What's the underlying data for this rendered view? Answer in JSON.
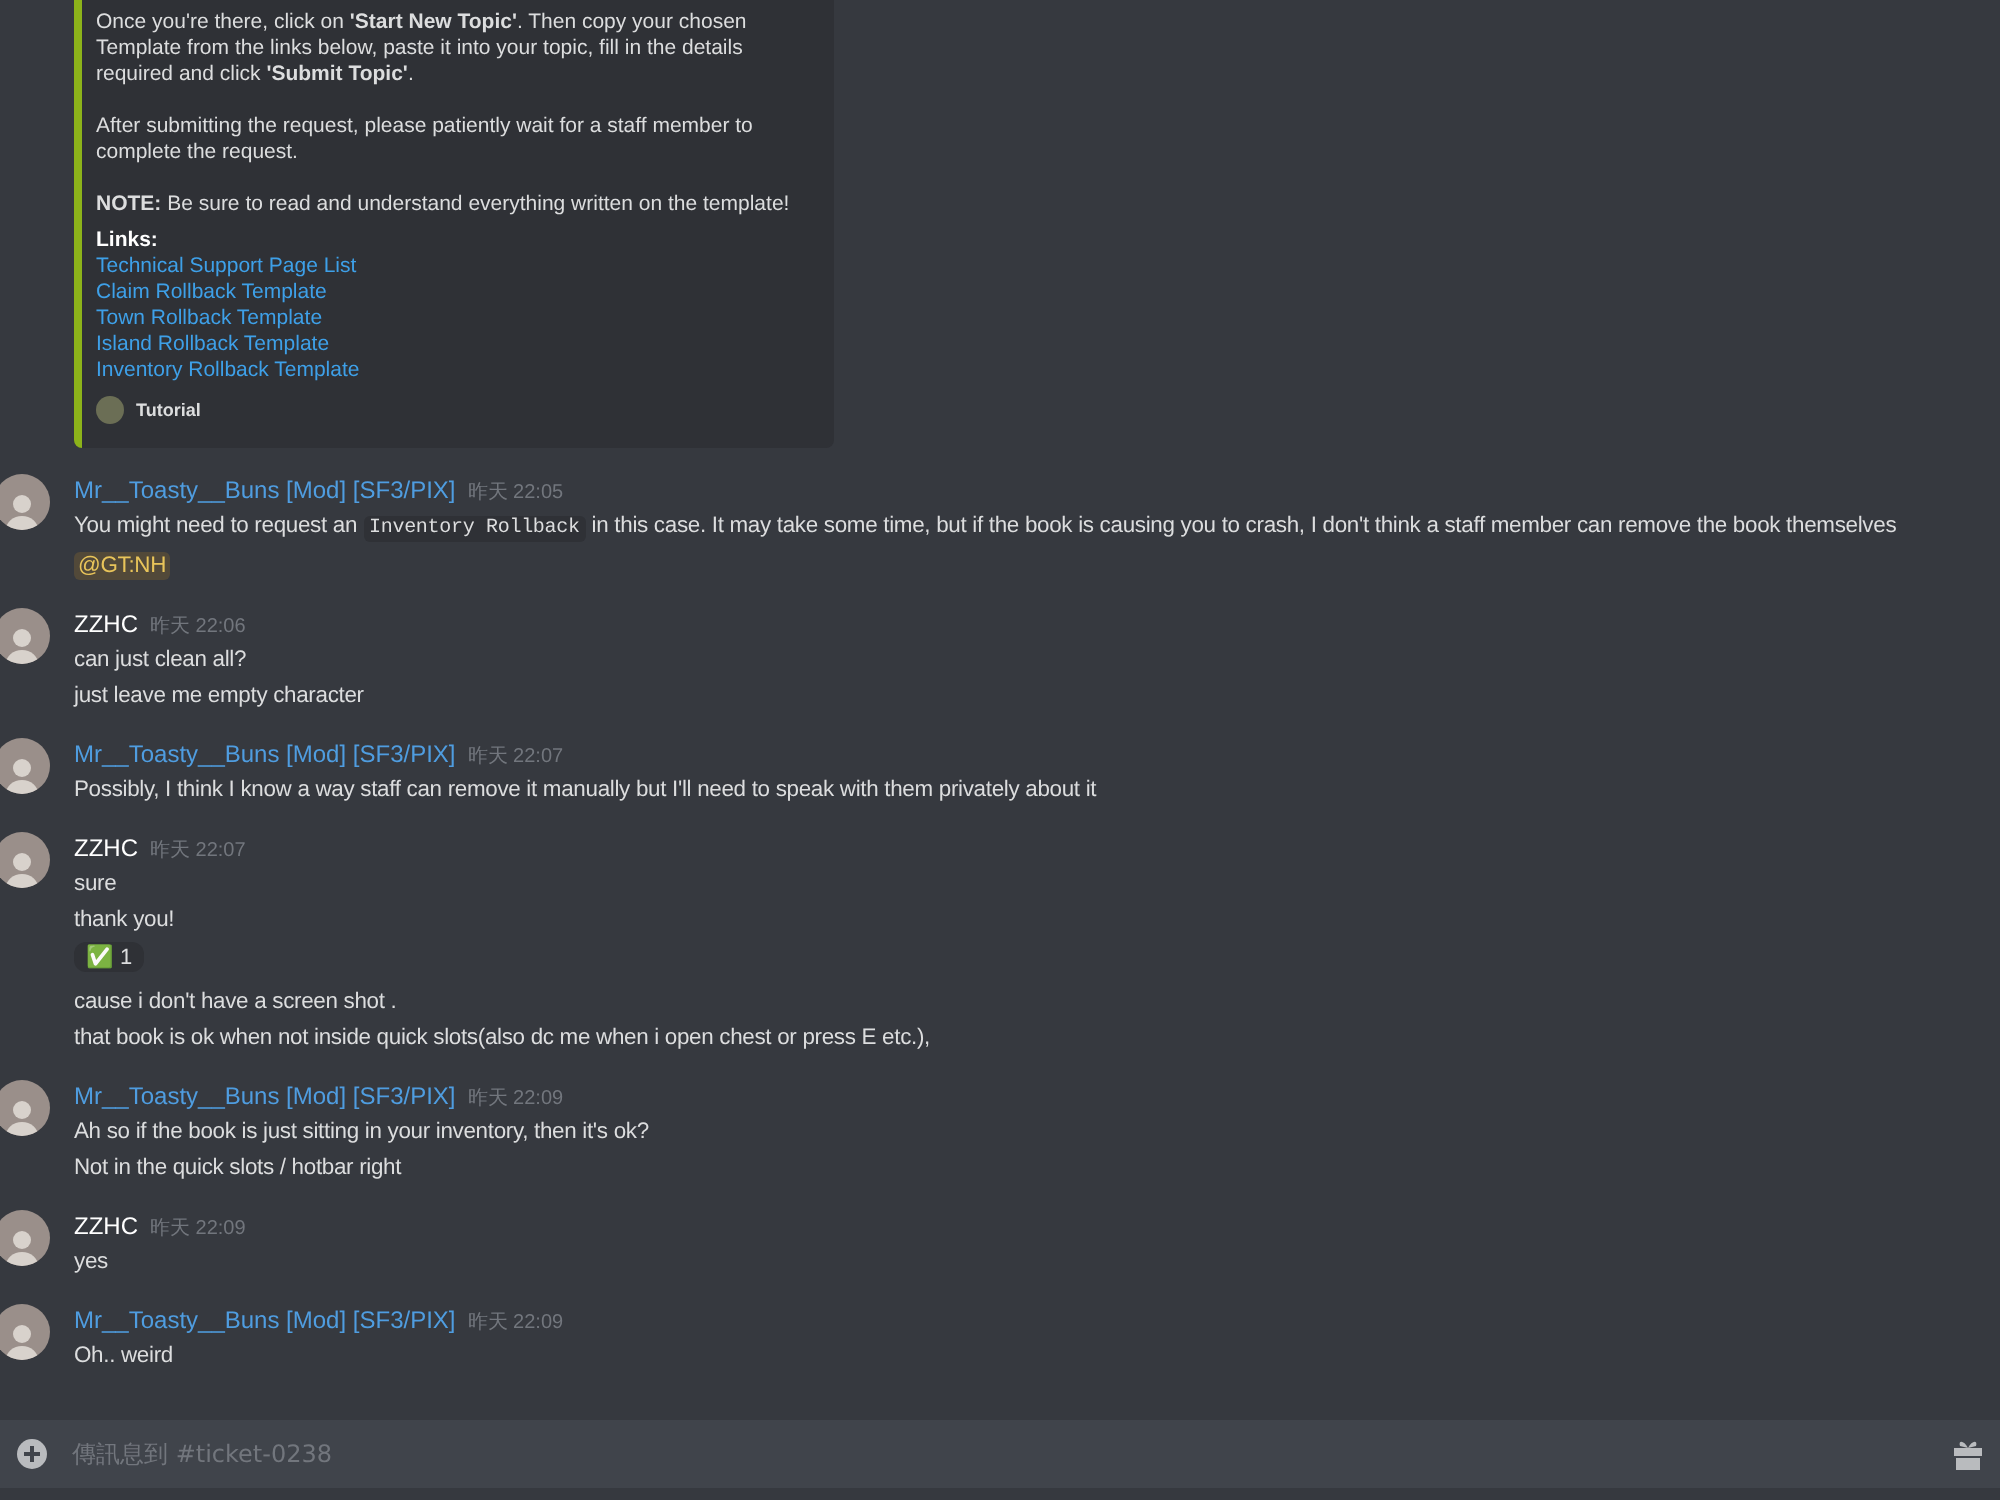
{
  "embed": {
    "paragraphs": [
      "Once you're there, click on **'Start New Topic'**. Then copy your chosen Template from the links below, paste it into your topic, fill in the details required and click **'Submit Topic'**.",
      "After submitting the request, please patiently wait for a staff member to complete the request.",
      "**NOTE:** Be sure to read and understand everything written on the template!"
    ],
    "links_heading": "Links:",
    "links": [
      "Technical Support Page List",
      "Claim Rollback Template",
      "Town Rollback Template",
      "Island Rollback Template",
      "Inventory Rollback Template"
    ],
    "footer": "Tutorial"
  },
  "messages": [
    {
      "author": "Mr__Toasty__Buns [Mod] [SF3/PIX]",
      "color": "#4f9de0",
      "time": "昨天 22:05",
      "lines": [
        {
          "kind": "text",
          "parts": [
            {
              "kind": "text",
              "text": "You might need to request an "
            },
            {
              "kind": "code",
              "text": "Inventory Rollback"
            },
            {
              "kind": "text",
              "text": " in this case. It may take some time, but if the book is causing you to crash, I don't think a staff member can remove the book themselves"
            }
          ]
        },
        {
          "kind": "text",
          "parts": [
            {
              "kind": "mention",
              "text": "@GT:NH"
            }
          ]
        }
      ]
    },
    {
      "author": "ZZHC",
      "color": "#ffffff",
      "time": "昨天 22:06",
      "lines": [
        {
          "kind": "text",
          "parts": [
            {
              "kind": "text",
              "text": "can just clean all?"
            }
          ]
        },
        {
          "kind": "text",
          "parts": [
            {
              "kind": "text",
              "text": "just leave me  empty character"
            }
          ]
        }
      ]
    },
    {
      "author": "Mr__Toasty__Buns [Mod] [SF3/PIX]",
      "color": "#4f9de0",
      "time": "昨天 22:07",
      "lines": [
        {
          "kind": "text",
          "parts": [
            {
              "kind": "text",
              "text": "Possibly, I think I know a way staff can remove it manually but I'll need to speak with them privately about it"
            }
          ]
        }
      ]
    },
    {
      "author": "ZZHC",
      "color": "#ffffff",
      "time": "昨天 22:07",
      "lines": [
        {
          "kind": "text",
          "parts": [
            {
              "kind": "text",
              "text": "sure"
            }
          ]
        },
        {
          "kind": "text",
          "parts": [
            {
              "kind": "text",
              "text": "thank you!"
            }
          ]
        },
        {
          "kind": "reaction",
          "emoji": "✅",
          "count": "1"
        },
        {
          "kind": "text",
          "parts": [
            {
              "kind": "text",
              "text": "cause i don't have a screen shot ."
            }
          ]
        },
        {
          "kind": "text",
          "parts": [
            {
              "kind": "text",
              "text": "that book is ok when not inside quick slots(also dc me when i open chest or press E etc.),"
            }
          ]
        }
      ]
    },
    {
      "author": "Mr__Toasty__Buns [Mod] [SF3/PIX]",
      "color": "#4f9de0",
      "time": "昨天 22:09",
      "lines": [
        {
          "kind": "text",
          "parts": [
            {
              "kind": "text",
              "text": "Ah so if the book is just sitting in your inventory, then it's ok?"
            }
          ]
        },
        {
          "kind": "text",
          "parts": [
            {
              "kind": "text",
              "text": "Not in the quick slots / hotbar right"
            }
          ]
        }
      ]
    },
    {
      "author": "ZZHC",
      "color": "#ffffff",
      "time": "昨天 22:09",
      "lines": [
        {
          "kind": "text",
          "parts": [
            {
              "kind": "text",
              "text": "yes"
            }
          ]
        }
      ]
    },
    {
      "author": "Mr__Toasty__Buns [Mod] [SF3/PIX]",
      "color": "#4f9de0",
      "time": "昨天 22:09",
      "lines": [
        {
          "kind": "text",
          "parts": [
            {
              "kind": "text",
              "text": "Oh.. weird"
            }
          ]
        }
      ]
    }
  ],
  "composer": {
    "placeholder": "傳訊息到 #ticket-0238"
  }
}
